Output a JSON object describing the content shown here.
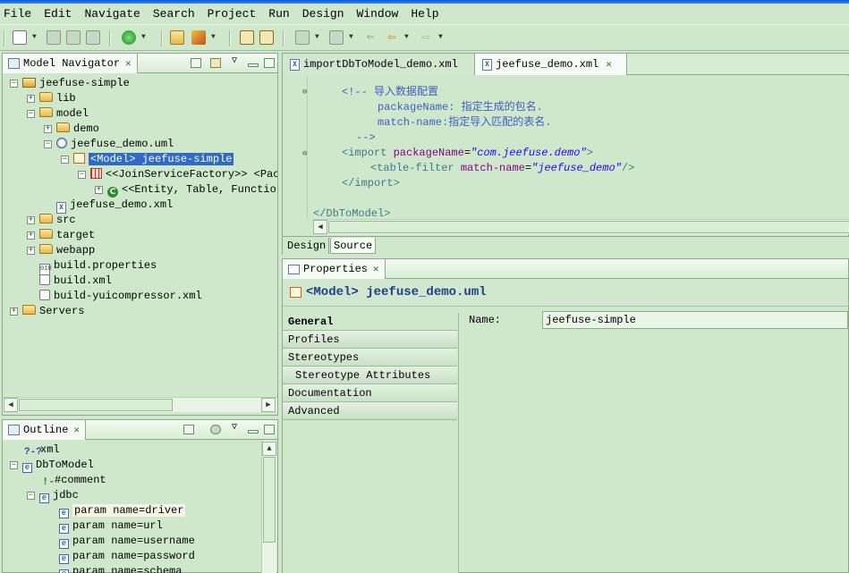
{
  "menu": [
    "File",
    "Edit",
    "Navigate",
    "Search",
    "Project",
    "Run",
    "Design",
    "Window",
    "Help"
  ],
  "navigator": {
    "title": "Model Navigator",
    "tree": [
      {
        "label": "jeefuse-simple",
        "icon": "project-icon"
      },
      {
        "label": "lib",
        "icon": "folder-icon"
      },
      {
        "label": "model",
        "icon": "folder-icon"
      },
      {
        "label": "demo",
        "icon": "folder-icon"
      },
      {
        "label": "jeefuse_demo.uml",
        "icon": "uml-file-icon"
      },
      {
        "label": "<Model> jeefuse-simple",
        "icon": "model-icon"
      },
      {
        "label": "<<JoinServiceFactory>> <Pac",
        "icon": "package-icon"
      },
      {
        "label": "<<Entity, Table, Functio",
        "icon": "class-icon"
      },
      {
        "label": "jeefuse_demo.xml",
        "icon": "xml-file-icon"
      },
      {
        "label": "src",
        "icon": "folder-icon"
      },
      {
        "label": "target",
        "icon": "folder-icon"
      },
      {
        "label": "webapp",
        "icon": "folder-icon"
      },
      {
        "label": "build.properties",
        "icon": "properties-file-icon"
      },
      {
        "label": "build.xml",
        "icon": "ant-file-icon"
      },
      {
        "label": "build-yuicompressor.xml",
        "icon": "ant-file-icon"
      },
      {
        "label": "Servers",
        "icon": "folder-icon"
      }
    ]
  },
  "outline": {
    "title": "Outline",
    "tree": [
      {
        "label": "xml",
        "icon": "processing-instruction-icon"
      },
      {
        "label": "DbToModel",
        "icon": "element-icon"
      },
      {
        "label": "#comment",
        "icon": "comment-icon"
      },
      {
        "label": "jdbc",
        "icon": "element-icon"
      },
      {
        "label": "param name=driver",
        "icon": "element-icon"
      },
      {
        "label": "param name=url",
        "icon": "element-icon"
      },
      {
        "label": "param name=username",
        "icon": "element-icon"
      },
      {
        "label": "param name=password",
        "icon": "element-icon"
      },
      {
        "label": "param name=schema",
        "icon": "element-icon"
      }
    ]
  },
  "editor": {
    "tabs": [
      {
        "label": "importDbToModel_demo.xml",
        "active": false
      },
      {
        "label": "jeefuse_demo.xml",
        "active": true
      }
    ],
    "code": {
      "l1": "<!-- 导入数据配置",
      "l2a": "packageName: ",
      "l2b": "指定生成的包名.",
      "l3a": "match-name:",
      "l3b": "指定导入匹配的表名.",
      "l4": "-->",
      "l5_tag": "<import ",
      "l5_attr": "packageName",
      "l5_eq": "=",
      "l5_val": "\"com.jeefuse.demo\"",
      "l5_end": ">",
      "l6_tag": "<table-filter ",
      "l6_attr": "match-name",
      "l6_eq": "=",
      "l6_val": "\"jeefuse_demo\"",
      "l6_end": "/>",
      "l7": "</import>",
      "l8": "</DbToModel>"
    },
    "bottom_tabs": [
      "Design",
      "Source"
    ]
  },
  "properties": {
    "title": "Properties",
    "heading": "<Model> jeefuse_demo.uml",
    "categories": [
      "General",
      "Profiles",
      "Stereotypes",
      "Stereotype Attributes",
      "Documentation",
      "Advanced"
    ],
    "name_label": "Name:",
    "name_value": "jeefuse-simple"
  }
}
